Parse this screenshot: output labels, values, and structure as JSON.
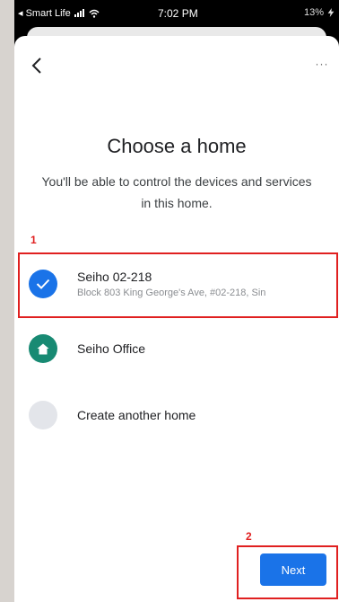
{
  "status_bar": {
    "carrier": "◂ Smart Life",
    "time": "7:02 PM",
    "battery": "13%"
  },
  "header": {
    "back_icon": "chevron-left-icon",
    "more_label": "···"
  },
  "main": {
    "title": "Choose a home",
    "subtitle": "You'll be able to control the devices and services in this home."
  },
  "annotations": {
    "marker_1": "1",
    "marker_2": "2",
    "color": "#e02020"
  },
  "homes": [
    {
      "name": "Seiho 02-218",
      "address": "Block 803 King George's Ave, #02-218, Sin",
      "selected": true,
      "icon": "check-icon",
      "icon_color": "#1a73e8"
    },
    {
      "name": "Seiho Office",
      "icon": "house-icon",
      "icon_color": "#188a73"
    },
    {
      "name": "Create another home",
      "icon": "placeholder-circle",
      "icon_color": "#e3e5ea"
    }
  ],
  "footer": {
    "next_label": "Next",
    "accent": "#1a73e8"
  }
}
